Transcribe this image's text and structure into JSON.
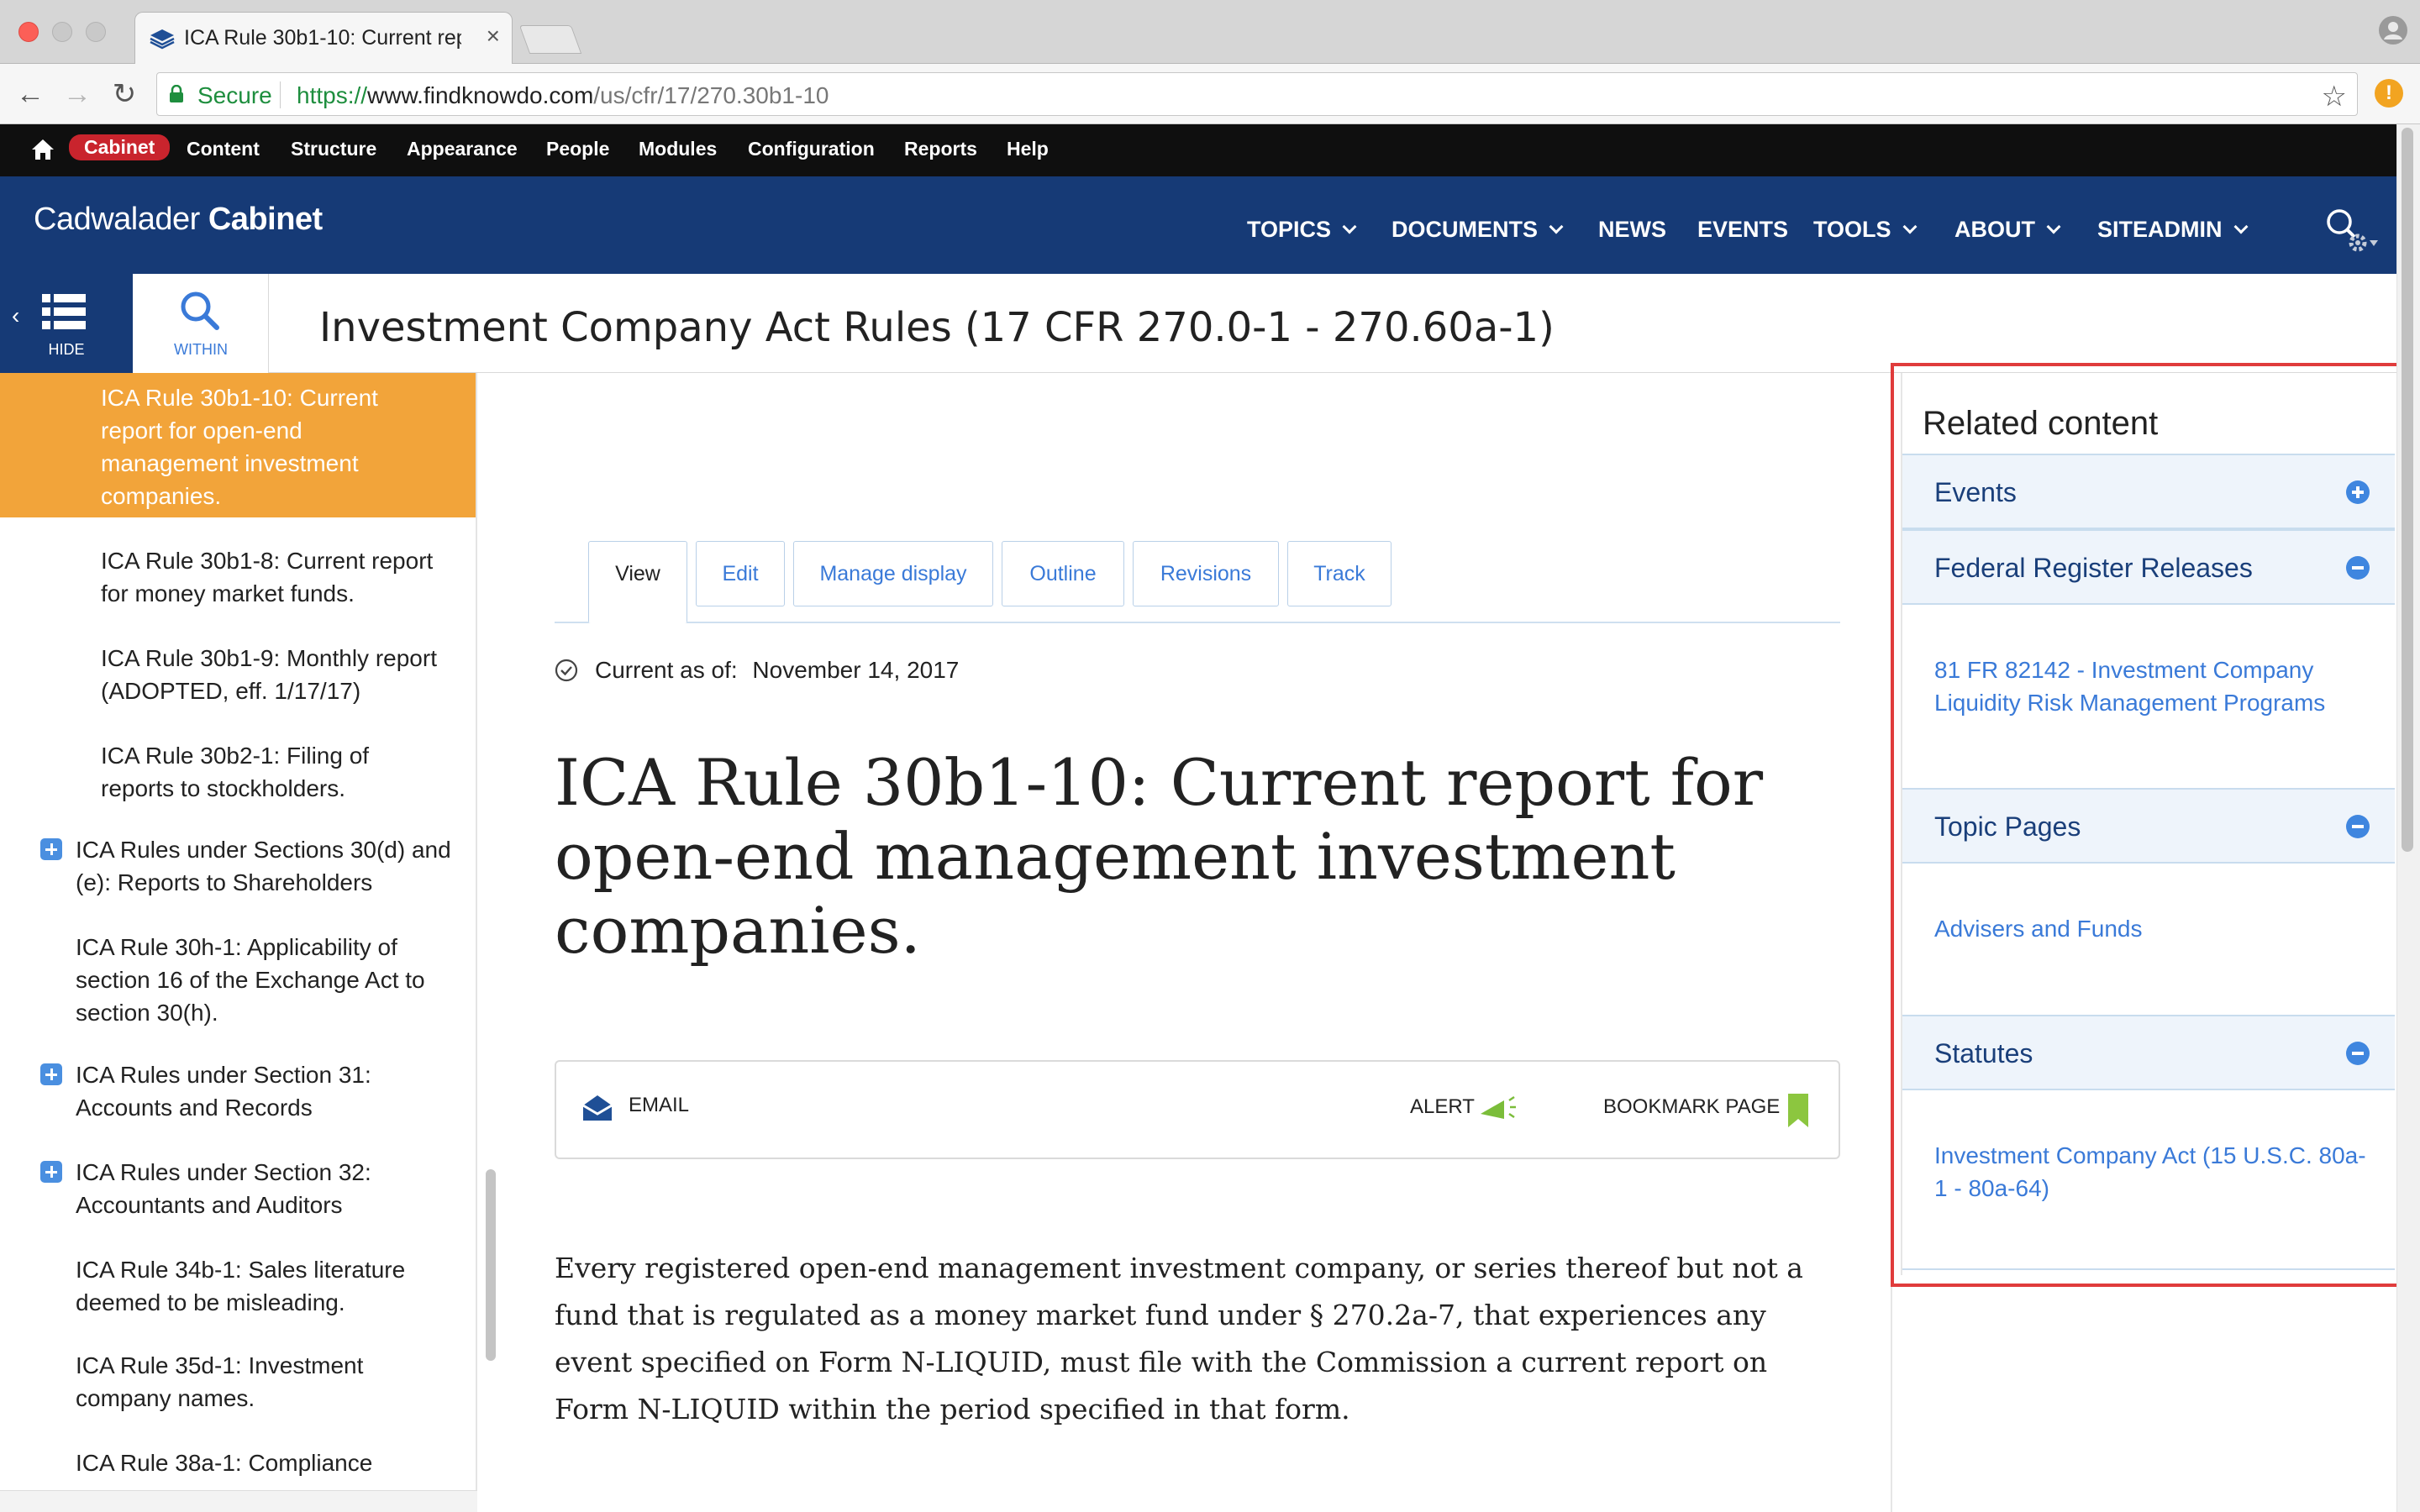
{
  "browser": {
    "tab_title": "ICA Rule 30b1-10: Current repo",
    "tab_close": "×",
    "secure_label": "Secure",
    "url_scheme": "https://",
    "url_host": "www.findknowdo.com",
    "url_path": "/us/cfr/17/270.30b1-10",
    "warn_badge": "!"
  },
  "adminbar": {
    "items": [
      "Cabinet",
      "Content",
      "Structure",
      "Appearance",
      "People",
      "Modules",
      "Configuration",
      "Reports",
      "Help"
    ]
  },
  "site": {
    "logo_light": "Cadwalader",
    "logo_bold": "Cabinet",
    "nav": [
      "TOPICS",
      "DOCUMENTS",
      "NEWS",
      "EVENTS",
      "TOOLS",
      "ABOUT",
      "SITEADMIN"
    ]
  },
  "titlebar": {
    "hide_label": "HIDE",
    "within_label": "WITHIN",
    "page_title": "Investment Company Act Rules (17 CFR 270.0-1 - 270.60a-1)"
  },
  "sidebar": {
    "items": [
      {
        "label": "ICA Rule 30b1-10: Current report for open-end management investment companies.",
        "active": true
      },
      {
        "label": "ICA Rule 30b1-8: Current report for money market funds."
      },
      {
        "label": "ICA Rule 30b1-9: Monthly report (ADOPTED, eff. 1/17/17)"
      },
      {
        "label": "ICA Rule 30b2-1: Filing of reports to stockholders."
      },
      {
        "label": "ICA Rules under Sections 30(d) and (e): Reports to Shareholders",
        "expandable": true
      },
      {
        "label": "ICA Rule 30h-1: Applicability of section 16 of the Exchange Act to section 30(h)."
      },
      {
        "label": "ICA Rules under Section 31: Accounts and Records",
        "expandable": true
      },
      {
        "label": "ICA Rules under Section 32: Accountants and Auditors",
        "expandable": true
      },
      {
        "label": "ICA Rule 34b-1: Sales literature deemed to be misleading."
      },
      {
        "label": "ICA Rule 35d-1: Investment company names."
      },
      {
        "label": "ICA Rule 38a-1: Compliance"
      }
    ]
  },
  "main": {
    "tabs": [
      "View",
      "Edit",
      "Manage display",
      "Outline",
      "Revisions",
      "Track"
    ],
    "current_as_of_label": "Current as of:",
    "current_as_of_date": "November 14, 2017",
    "heading": "ICA Rule 30b1-10: Current report for open-end management investment companies.",
    "actions": {
      "email": "EMAIL",
      "alert": "ALERT",
      "bookmark": "BOOKMARK PAGE"
    },
    "body": "Every registered open-end management investment company, or series thereof but not a fund that is regulated as a money market fund under § 270.2a-7, that experiences any event specified on Form N-LIQUID, must file with the Commission a current report on Form N-LIQUID within the period specified in that form."
  },
  "related": {
    "title": "Related content",
    "sections": [
      {
        "label": "Events",
        "state": "collapsed"
      },
      {
        "label": "Federal Register Releases",
        "state": "expanded",
        "links": [
          "81 FR 82142 - Investment Company Liquidity Risk Management Programs"
        ]
      },
      {
        "label": "Topic Pages",
        "state": "expanded",
        "links": [
          "Advisers and Funds"
        ]
      },
      {
        "label": "Statutes",
        "state": "expanded",
        "links": [
          "Investment Company Act (15 U.S.C. 80a-1 - 80a-64)"
        ]
      }
    ]
  },
  "colors": {
    "admin_bar": "#0f0f0f",
    "header_blue": "#163a76",
    "active_orange": "#f2a43a",
    "link_blue": "#3a7ad8",
    "highlight_red": "#e03c3c"
  }
}
